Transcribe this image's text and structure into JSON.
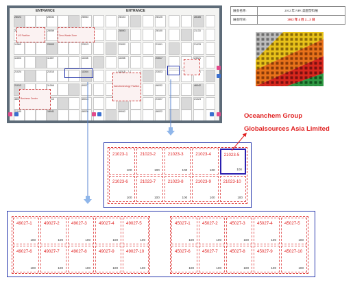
{
  "floorplan": {
    "entrance_labels": [
      "ENTRANCE",
      "ENTRANCE"
    ],
    "booth_codes": [
      "28023",
      "28033",
      "28063",
      "28103",
      "28125",
      "28185",
      "28048",
      "28059",
      "28073",
      "28093",
      "28100",
      "21133",
      "11063",
      "23003",
      "23013",
      "23032",
      "21001",
      "21033",
      "11003",
      "11007",
      "11045",
      "11055",
      "23017",
      "23021",
      "21024",
      "21010",
      "11004",
      "11015",
      "23023",
      "27101",
      "21013",
      "11099",
      "49027",
      "45027",
      "46032",
      "46042",
      "48031",
      "48013",
      "45013",
      "48033",
      "21027",
      "21023",
      "21045",
      "18041",
      "48026",
      "49042",
      "46022"
    ],
    "zone_labels": [
      "US Pavilion",
      "Zero Waste Zone",
      "Business Center",
      "Nanotechnology Pavilion"
    ]
  },
  "info_table": {
    "rows": [
      {
        "key": "展会名称:",
        "value": "2012 年 NPE 美国塑料展"
      },
      {
        "key": "展会时间:",
        "value": "2012 年 4 月 2—5 日"
      }
    ]
  },
  "companies": [
    "Oceanchem Group",
    "Globalsources Asia Limited"
  ],
  "detail_21023": {
    "booths": [
      {
        "name": "21023-1",
        "size": "100"
      },
      {
        "name": "21023-2",
        "size": "100"
      },
      {
        "name": "21023-3",
        "size": "100"
      },
      {
        "name": "21023-4",
        "size": "100"
      },
      {
        "name": "21023-5",
        "size": "100"
      },
      {
        "name": "21023-6",
        "size": "100"
      },
      {
        "name": "21023-7",
        "size": "100"
      },
      {
        "name": "21023-8",
        "size": "100"
      },
      {
        "name": "21023-9",
        "size": "100"
      },
      {
        "name": "21023-10",
        "size": "100"
      }
    ],
    "highlighted": "21023-5"
  },
  "detail_49027": {
    "booths": [
      {
        "name": "49027-1",
        "size": "100"
      },
      {
        "name": "49027-2",
        "size": "100"
      },
      {
        "name": "49027-3",
        "size": "100"
      },
      {
        "name": "49027-4",
        "size": "100"
      },
      {
        "name": "49027-5",
        "size": "100"
      },
      {
        "name": "49027-6",
        "size": "100"
      },
      {
        "name": "49027-7",
        "size": "100"
      },
      {
        "name": "49027-8",
        "size": "100"
      },
      {
        "name": "49027-9",
        "size": "100"
      },
      {
        "name": "49027-10",
        "size": "100"
      }
    ]
  },
  "detail_45027": {
    "booths": [
      {
        "name": "45027-1",
        "size": "100"
      },
      {
        "name": "45027-2",
        "size": "100"
      },
      {
        "name": "45027-3",
        "size": "100"
      },
      {
        "name": "45027-4",
        "size": "100"
      },
      {
        "name": "45027-5",
        "size": "100"
      },
      {
        "name": "45027-6",
        "size": "100"
      },
      {
        "name": "45027-7",
        "size": "100"
      },
      {
        "name": "45027-8",
        "size": "100"
      },
      {
        "name": "45027-9",
        "size": "100"
      },
      {
        "name": "45027-10",
        "size": "100"
      }
    ]
  },
  "colors": {
    "accent_red": "#e01f1f",
    "frame_blue": "#2233aa",
    "arrow_blue": "#5a86d0"
  }
}
